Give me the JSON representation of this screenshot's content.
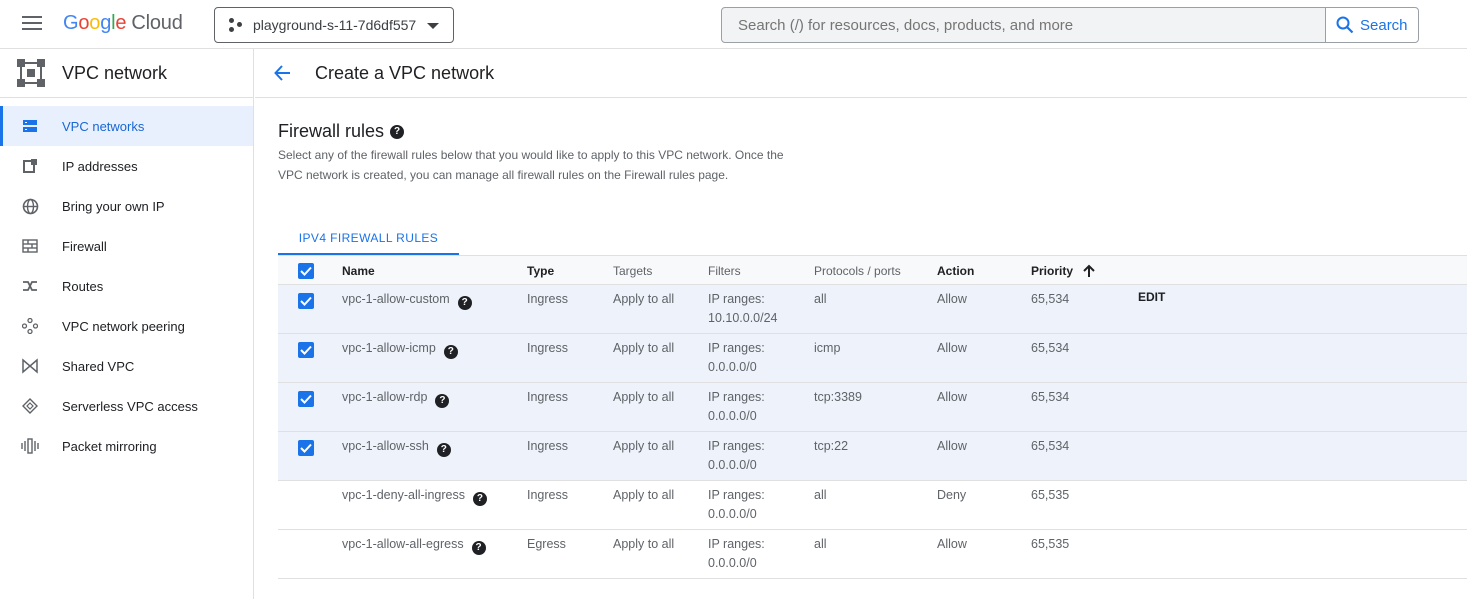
{
  "header": {
    "logo_google": [
      "G",
      "o",
      "o",
      "g",
      "l",
      "e"
    ],
    "logo_cloud": "Cloud",
    "project": "playground-s-11-7d6df557",
    "search_placeholder": "Search (/) for resources, docs, products, and more",
    "search_button": "Search"
  },
  "sidebar": {
    "title": "VPC network",
    "items": [
      {
        "label": "VPC networks",
        "icon": "vpc-networks-icon",
        "active": true
      },
      {
        "label": "IP addresses",
        "icon": "ip-addresses-icon"
      },
      {
        "label": "Bring your own IP",
        "icon": "globe-icon"
      },
      {
        "label": "Firewall",
        "icon": "firewall-icon"
      },
      {
        "label": "Routes",
        "icon": "routes-icon"
      },
      {
        "label": "VPC network peering",
        "icon": "peering-icon"
      },
      {
        "label": "Shared VPC",
        "icon": "shared-vpc-icon"
      },
      {
        "label": "Serverless VPC access",
        "icon": "serverless-icon"
      },
      {
        "label": "Packet mirroring",
        "icon": "packet-mirroring-icon"
      }
    ]
  },
  "main": {
    "title": "Create a VPC network",
    "section_title": "Firewall rules",
    "description": "Select any of the firewall rules below that you would like to apply to this VPC network. Once the VPC network is created, you can manage all firewall rules on the Firewall rules page.",
    "tab": "IPV4 FIREWALL RULES",
    "table": {
      "columns": {
        "name": "Name",
        "type": "Type",
        "targets": "Targets",
        "filters": "Filters",
        "protocols": "Protocols / ports",
        "action": "Action",
        "priority": "Priority"
      },
      "edit_label": "EDIT",
      "rows": [
        {
          "selected": true,
          "name": "vpc-1-allow-custom",
          "type": "Ingress",
          "targets": "Apply to all",
          "filters_1": "IP ranges:",
          "filters_2": "10.10.0.0/24",
          "protocols": "all",
          "action": "Allow",
          "priority": "65,534"
        },
        {
          "selected": true,
          "name": "vpc-1-allow-icmp",
          "type": "Ingress",
          "targets": "Apply to all",
          "filters_1": "IP ranges:",
          "filters_2": "0.0.0.0/0",
          "protocols": "icmp",
          "action": "Allow",
          "priority": "65,534"
        },
        {
          "selected": true,
          "name": "vpc-1-allow-rdp",
          "type": "Ingress",
          "targets": "Apply to all",
          "filters_1": "IP ranges:",
          "filters_2": "0.0.0.0/0",
          "protocols": "tcp:3389",
          "action": "Allow",
          "priority": "65,534"
        },
        {
          "selected": true,
          "name": "vpc-1-allow-ssh",
          "type": "Ingress",
          "targets": "Apply to all",
          "filters_1": "IP ranges:",
          "filters_2": "0.0.0.0/0",
          "protocols": "tcp:22",
          "action": "Allow",
          "priority": "65,534"
        },
        {
          "selected": false,
          "name": "vpc-1-deny-all-ingress",
          "type": "Ingress",
          "targets": "Apply to all",
          "filters_1": "IP ranges:",
          "filters_2": "0.0.0.0/0",
          "protocols": "all",
          "action": "Deny",
          "priority": "65,535"
        },
        {
          "selected": false,
          "name": "vpc-1-allow-all-egress",
          "type": "Egress",
          "targets": "Apply to all",
          "filters_1": "IP ranges:",
          "filters_2": "0.0.0.0/0",
          "protocols": "all",
          "action": "Allow",
          "priority": "65,535"
        }
      ]
    }
  },
  "colors": {
    "accent": "#1a73e8",
    "selected_row": "#eef3fb",
    "active_nav": "#e8f0fe"
  }
}
